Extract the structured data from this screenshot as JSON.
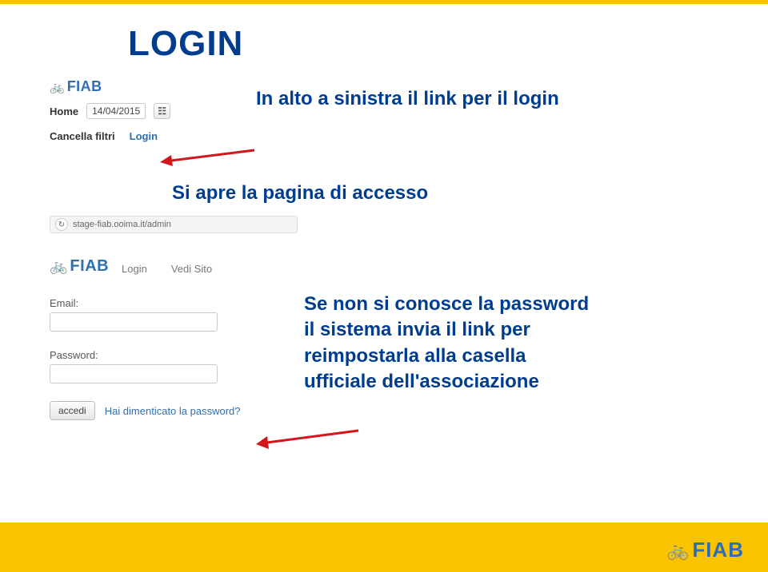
{
  "title": "LOGIN",
  "captions": {
    "top_right": "In alto a sinistra il link per il login",
    "open_page": "Si apre la pagina di accesso",
    "forgot_help_1": "Se non si conosce la password",
    "forgot_help_2": "il sistema invia il link per",
    "forgot_help_3": "reimpostarla alla casella",
    "forgot_help_4": "ufficiale dell'associazione"
  },
  "logo": {
    "bike_glyph": "🚲",
    "text": "FIAB"
  },
  "shot1": {
    "home_label": "Home",
    "date_value": "14/04/2015",
    "calendar_glyph": "☷",
    "cancel_filters": "Cancella filtri",
    "login_link": "Login"
  },
  "shot2": {
    "reload_glyph": "↻",
    "url_text": "stage-fiab.ooima.it/admin",
    "tab_login": "Login",
    "tab_view_site": "Vedi Sito",
    "email_label": "Email:",
    "password_label": "Password:",
    "submit_label": "accedi",
    "forgot_label": "Hai dimenticato la password?"
  }
}
